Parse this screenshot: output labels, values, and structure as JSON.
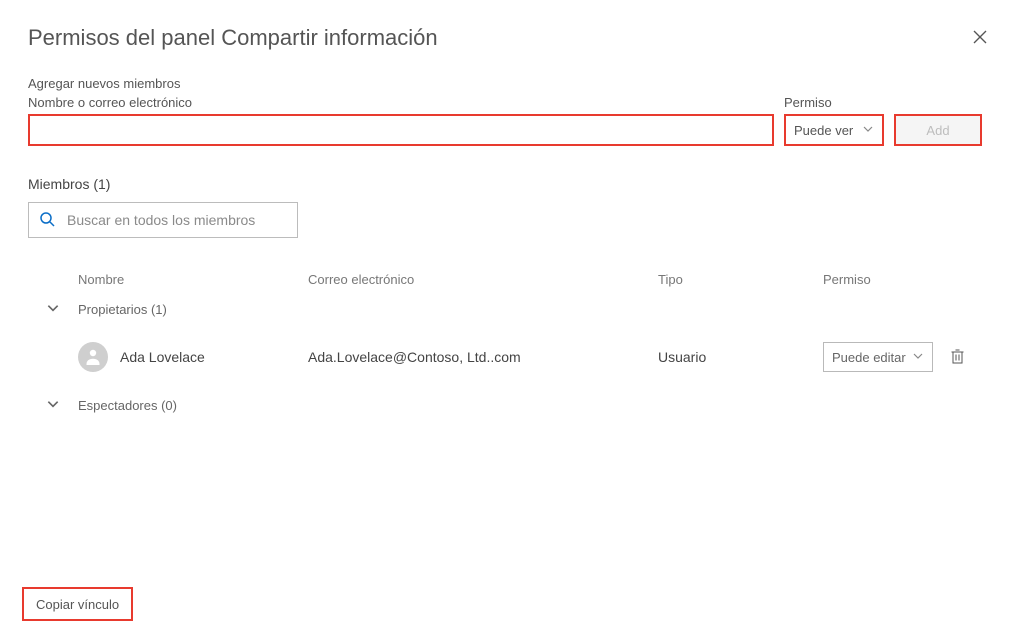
{
  "header": {
    "title": "Permisos del panel Compartir información"
  },
  "add_section": {
    "section_label": "Agregar nuevos miembros",
    "name_field_label": "Nombre o correo electrónico",
    "name_value": "",
    "perm_field_label": "Permiso",
    "perm_selected": "Puede ver",
    "add_button": "Add"
  },
  "members": {
    "heading": "Miembros (1)",
    "search_placeholder": "Buscar en todos los miembros",
    "columns": {
      "name": "Nombre",
      "email": "Correo electrónico",
      "type": "Tipo",
      "perm": "Permiso"
    },
    "groups": {
      "owners": {
        "label": "Propietarios (1)",
        "rows": [
          {
            "name": "Ada Lovelace",
            "email": "Ada.Lovelace@Contoso, Ltd..com",
            "type": "Usuario",
            "perm": "Puede editar"
          }
        ]
      },
      "viewers": {
        "label": "Espectadores (0)"
      }
    }
  },
  "footer": {
    "copy_link": "Copiar vínculo"
  }
}
